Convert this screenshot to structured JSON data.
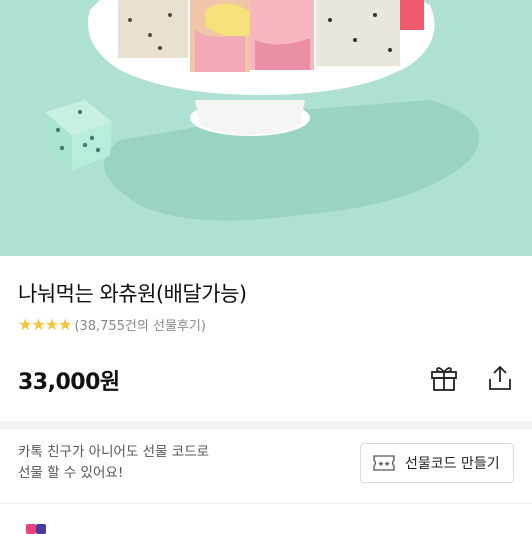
{
  "product": {
    "title": "나눠먹는 와츄원(배달가능)",
    "rating_count": "(38,755건의 선물후기)",
    "stars": 4,
    "price": "33,000원"
  },
  "actions": {
    "gift_icon": "gift-icon",
    "share_icon": "share-icon"
  },
  "promo": {
    "line1": "카톡 친구가 아니어도 선물 코드로",
    "line2": "선물 할 수 있어요!",
    "code_button_label": "선물코드 만들기",
    "code_icon": "ticket-icon"
  },
  "colors": {
    "hero_bg": "#aee0d4",
    "star": "#f5c33b"
  }
}
